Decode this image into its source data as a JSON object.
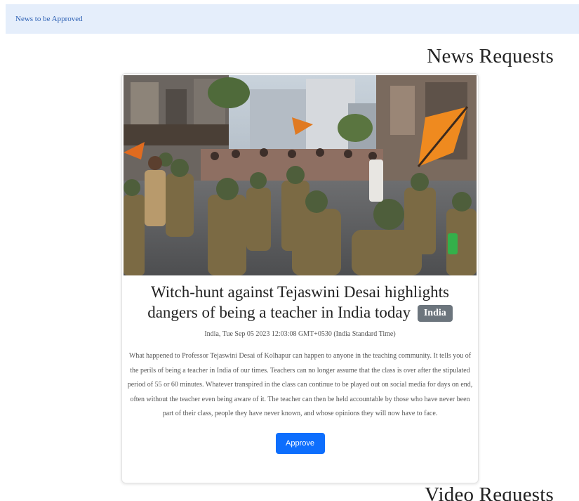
{
  "navbar": {
    "brand": "News to be Approved"
  },
  "sections": {
    "news_title": "News Requests",
    "video_title": "Video Requests"
  },
  "news_card": {
    "image_icon": "news-photo-image",
    "title": "Witch-hunt against Tejaswini Desai highlights dangers of being a teacher in India today",
    "badge": "India",
    "meta": "India, Tue Sep 05 2023 12:03:08 GMT+0530 (India Standard Time)",
    "summary": "What happened to Professor Tejaswini Desai of Kolhapur can happen to anyone in the teaching community. It tells you of the perils of being a teacher in India of our times. Teachers can no longer assume that the class is over after the stipulated period of 55 or 60 minutes. Whatever transpired in the class can continue to be played out on social media for days on end, often without the teacher even being aware of it. The teacher can then be held accountable by those who have never been part of their class, people they have never known, and whose opinions they will now have to face.",
    "approve_label": "Approve"
  },
  "colors": {
    "navbar_bg": "#e5eefb",
    "brand_link": "#2b5fb3",
    "badge_bg": "#6c757d",
    "primary_button": "#0d6efd"
  }
}
